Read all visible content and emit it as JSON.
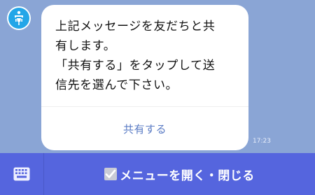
{
  "message": {
    "avatar_icon": "bot-icon",
    "text": "上記メッセージを友だちと共\n有します。\n「共有する」をタップして送\n信先を選んで下さい。",
    "share_label": "共有する",
    "time": "17:23"
  },
  "bottom_bar": {
    "keyboard_icon": "keyboard-icon",
    "menu_label": "メニューを開く・閉じる",
    "check_icon": "checkbox-icon"
  },
  "colors": {
    "chat_background": "#8aa5d5",
    "bar_background": "#5565de",
    "link": "#5a7bc4",
    "avatar": "#23a6e8"
  }
}
